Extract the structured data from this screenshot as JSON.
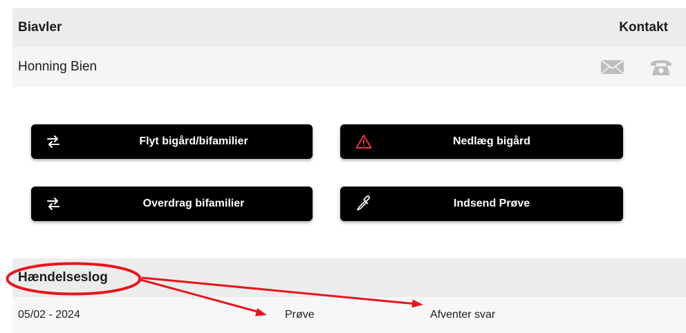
{
  "beekeeper_table": {
    "header": {
      "name_label": "Biavler",
      "contact_label": "Kontakt"
    },
    "rows": [
      {
        "name": "Honning Bien",
        "contact_icons": [
          "envelope-icon",
          "phone-icon"
        ]
      }
    ]
  },
  "actions": [
    {
      "label": "Flyt bigård/bifamilier",
      "icon": "swap-arrows-icon"
    },
    {
      "label": "Nedlæg bigård",
      "icon": "warning-triangle-icon"
    },
    {
      "label": "Overdrag bifamilier",
      "icon": "swap-arrows-icon"
    },
    {
      "label": "Indsend Prøve",
      "icon": "pipette-icon"
    }
  ],
  "event_log": {
    "header": "Hændelseslog",
    "rows": [
      {
        "date": "05/02 - 2024",
        "type": "Prøve",
        "status": "Afventer svar"
      }
    ]
  },
  "colors": {
    "header_bg": "#ececec",
    "row_bg": "#f5f5f5",
    "button_bg": "#000000",
    "button_text": "#ffffff",
    "warning_icon": "#e53935",
    "contact_icon": "#bdbdbd",
    "annotation": "#e8141c"
  }
}
